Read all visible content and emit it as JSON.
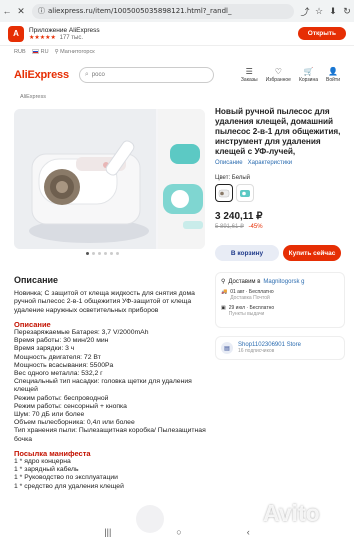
{
  "browser": {
    "back_icon": "←",
    "close_icon": "✕",
    "url": "aliexpress.ru/item/1005005035898121.html?_randl_",
    "share_icon": "⤴",
    "bookmark_icon": "☆",
    "download_icon": "⬇",
    "info_icon": "ⓘ",
    "refresh_icon": "↻"
  },
  "app_banner": {
    "logo_text": "A",
    "name": "Приложение AliExpress",
    "stars": "★★★★★",
    "reviews": "177 тыс.",
    "open_label": "Открыть"
  },
  "top_row": {
    "currency": "RUB",
    "lang": "RU",
    "location": "Магнитогорск"
  },
  "header": {
    "logo": "AliExpress",
    "search_placeholder": "poco",
    "icons": [
      {
        "icon": "☰",
        "label": "Заказы"
      },
      {
        "icon": "♡",
        "label": "Избранное"
      },
      {
        "icon": "🛒",
        "label": "Корзина"
      },
      {
        "icon": "👤",
        "label": "Войти"
      }
    ]
  },
  "breadcrumb": "AliExpress",
  "product": {
    "title": "Новый ручной пылесос для удаления клещей, домашний пылесос 2-в-1 для общежития, инструмент для удаления клещей с УФ-лучей,",
    "link_reviews": "Описание",
    "link_specs": "Характеристики",
    "color_label": "Цвет: Белый",
    "price": "3 240,11 ₽",
    "old_price": "5 891,61 ₽",
    "discount": "-45%",
    "cart_label": "В корзину",
    "buy_label": "Купить сейчас"
  },
  "delivery": {
    "head_prefix": "Доставим в",
    "city": "Magnitogorsk g",
    "line1_date": "01 авг",
    "line1_price": "Бесплатно",
    "line1_sub": "Доставка Почтой",
    "line2_date": "29 июл",
    "line2_price": "Бесплатно",
    "line2_sub": "Пункты выдачи"
  },
  "store": {
    "name": "Shop1102306901 Store",
    "subs": "16 подписчиков"
  },
  "description": {
    "heading": "Описание",
    "intro": "Новинка; С защитой от клеща жидкость для снятия дома ручной пылесос 2-в-1 общежития УФ-защитой от клеща удаление наружных осветительных приборов",
    "spec_heading": "Описание",
    "specs": [
      "Перезаряжаемые Батарея: 3,7 V/2000mAh",
      "Время работы: 30 мин/20 мин",
      "Время зарядки: 3 ч",
      "Мощность двигателя: 72 Вт",
      "Мощность всасывания: 5500Pa",
      "Вес одного металла: 532,2 г",
      "Специальный тип насадки: головка щетки для удаления клещей",
      "Режим работы: беспроводной",
      "Режим работы: сенсорный + кнопка",
      "Шум: 70 дБ или более",
      "Объем пылесборника: 0,4л или более",
      "Тип хранения пыли: Пылезащитная коробка/ Пылезащитная бочка"
    ],
    "package_heading": "Посылка манифеста",
    "package": [
      "1 * ядро концерна",
      "1 * зарядный кабель",
      "1 * Руководство по эксплуатации",
      "1 * средство для удаления клещей"
    ]
  },
  "navbar": {
    "recent_icon": "|||",
    "home_icon": "○",
    "back_icon": "‹"
  },
  "colors": {
    "brand": "#e62e04",
    "link": "#2b6cb0",
    "teal": "#5cc9c4"
  }
}
